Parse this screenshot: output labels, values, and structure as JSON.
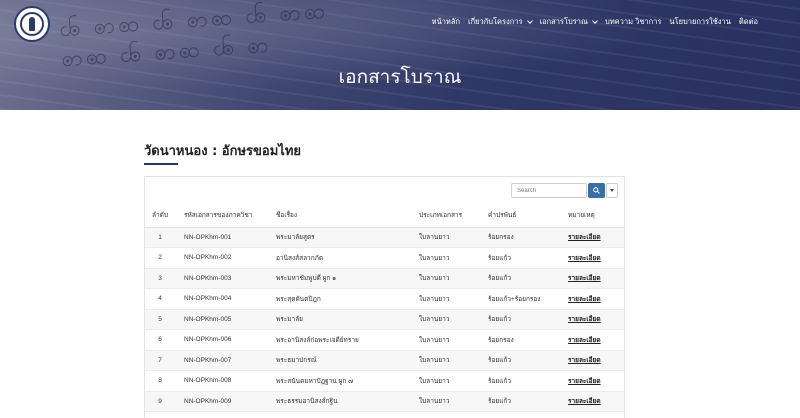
{
  "header": {
    "nav": [
      {
        "label": "หน้าหลัก",
        "dropdown": false
      },
      {
        "label": "เกี่ยวกับโครงการ",
        "dropdown": true
      },
      {
        "label": "เอกสารโบราณ",
        "dropdown": true
      },
      {
        "label": "บทความ วิชาการ",
        "dropdown": false
      },
      {
        "label": "นโยบายการใช้งาน",
        "dropdown": false
      },
      {
        "label": "ติดต่อ",
        "dropdown": false
      }
    ],
    "hero_title": "เอกสารโบราณ"
  },
  "section": {
    "title": "วัดนาหนอง : อักษรขอมไทย"
  },
  "search": {
    "placeholder": "Search"
  },
  "table": {
    "columns": [
      "ลำดับ",
      "รหัสเอกสารของภาควิชา",
      "ชื่อเรื่อง",
      "ประเภทเอกสาร",
      "คำปรพันธ์",
      "หมายเหตุ"
    ],
    "rows": [
      [
        "1",
        "NN-OPKhm-001",
        "พระมาลัยสูตร",
        "ใบลานยาว",
        "ร้อยกรอง",
        "รายละเอียด"
      ],
      [
        "2",
        "NN-OPKhm-002",
        "อานิสงส์สลากภัต",
        "ใบลานยาว",
        "ร้อยแก้ว",
        "รายละเอียด"
      ],
      [
        "3",
        "NN-OPKhm-003",
        "พระมหาชัมพูบดี ผูก ๑",
        "ใบลานยาว",
        "ร้อยแก้ว",
        "รายละเอียด"
      ],
      [
        "4",
        "NN-OPKhm-004",
        "พระสุตตันตปิฎก",
        "ใบลานยาว",
        "ร้อยแก้ว+ร้อยกรอง",
        "รายละเอียด"
      ],
      [
        "5",
        "NN-OPKhm-005",
        "พระมาลัย",
        "ใบลานยาว",
        "ร้อยแก้ว",
        "รายละเอียด"
      ],
      [
        "6",
        "NN-OPKhm-006",
        "พระอานิสงส์ก่อพระเจดีย์ทราย",
        "ใบลานยาว",
        "ร้อยกรอง",
        "รายละเอียด"
      ],
      [
        "7",
        "NN-OPKhm-007",
        "พระธมาปกรณ์",
        "ใบลานยาว",
        "ร้อยแก้ว",
        "รายละเอียด"
      ],
      [
        "8",
        "NN-OPKhm-008",
        "พระสนันตมหาปัฏฐาน ผูก ๗",
        "ใบลานยาว",
        "ร้อยแก้ว",
        "รายละเอียด"
      ],
      [
        "9",
        "NN-OPKhm-009",
        "พระธรรมอานิสงส์กฐิน",
        "ใบลานยาว",
        "ร้อยแก้ว",
        "รายละเอียด"
      ]
    ]
  },
  "colors": {
    "hero": "#2f3766",
    "accent": "#2c3361",
    "search_button": "#3a6ea5"
  }
}
